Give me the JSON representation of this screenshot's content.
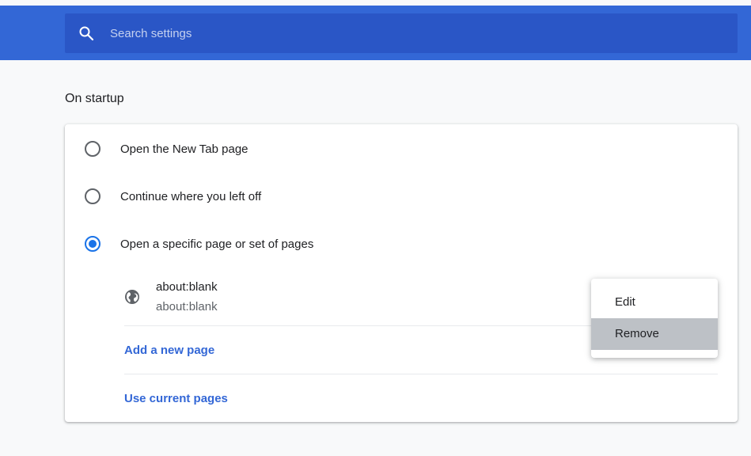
{
  "search": {
    "placeholder": "Search settings"
  },
  "section": {
    "title": "On startup"
  },
  "startup_options": [
    {
      "label": "Open the New Tab page",
      "checked": false
    },
    {
      "label": "Continue where you left off",
      "checked": false
    },
    {
      "label": "Open a specific page or set of pages",
      "checked": true
    }
  ],
  "pages": [
    {
      "title": "about:blank",
      "url": "about:blank",
      "icon": "globe-icon"
    }
  ],
  "actions": {
    "add_page": "Add a new page",
    "use_current": "Use current pages"
  },
  "context_menu": {
    "items": [
      "Edit",
      "Remove"
    ],
    "highlighted": "Remove"
  },
  "colors": {
    "header": "#3367d6",
    "search_bg": "#2a56c6",
    "accent": "#1a73e8",
    "link": "#3367d6"
  }
}
